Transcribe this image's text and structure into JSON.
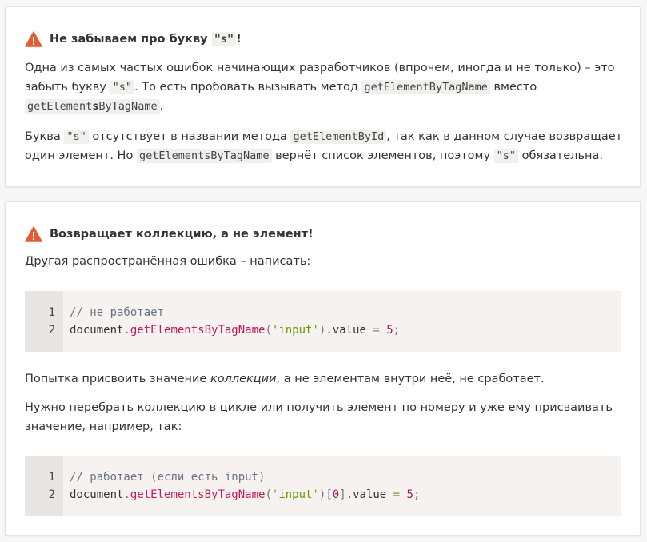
{
  "panel1": {
    "title_prefix": "Не забываем про букву",
    "title_code": "\"s\"",
    "title_suffix": "!",
    "para1": {
      "t1": "Одна из самых частых ошибок начинающих разработчиков (впрочем, иногда и не только) – это",
      "t2": "забыть букву",
      "c1": "\"s\"",
      "t3": ". То есть пробовать вызывать метод",
      "c2": "getElementByTagName",
      "t4": "вместо",
      "c3a": "getElement",
      "c3b": "s",
      "c3c": "ByTagName",
      "t5": "."
    },
    "para2": {
      "t1": "Буква",
      "c1": "\"s\"",
      "t2": "отсутствует в названии метода",
      "c2": "getElementById",
      "t3": ", так как в данном случае возвращает",
      "t4": "один элемент. Но",
      "c3": "getElementsByTagName",
      "t5": "вернёт список элементов, поэтому",
      "c4": "\"s\"",
      "t6": "обязательна."
    }
  },
  "panel2": {
    "title": "Возвращает коллекцию, а не элемент!",
    "intro": "Другая распространённая ошибка – написать:",
    "code1": {
      "line_numbers": [
        "1",
        "2"
      ],
      "comment": "// не работает",
      "obj": "document",
      "dot": ".",
      "method": "getElementsByTagName",
      "lparen": "(",
      "arg": "'input'",
      "rparen": ")",
      "prop": ".value",
      "eq": "=",
      "num": "5",
      "semi": ";"
    },
    "para_mid": {
      "t1": "Попытка присвоить значение",
      "em": "коллекции",
      "t2": ", а не элементам внутри неё, не сработает."
    },
    "para_last": {
      "l1": "Нужно перебрать коллекцию в цикле или получить элемент по номеру и уже ему присваивать",
      "l2": "значение, например, так:"
    },
    "code2": {
      "line_numbers": [
        "1",
        "2"
      ],
      "comment": "// работает (если есть input)",
      "obj": "document",
      "dot": ".",
      "method": "getElementsByTagName",
      "lparen": "(",
      "arg": "'input'",
      "rparen": ")",
      "lbr": "[",
      "idx": "0",
      "rbr": "]",
      "prop": ".value",
      "eq": "=",
      "num": "5",
      "semi": ";"
    }
  },
  "icons": {
    "warning": "warning-triangle-icon",
    "warning_color": "#e25d33"
  }
}
